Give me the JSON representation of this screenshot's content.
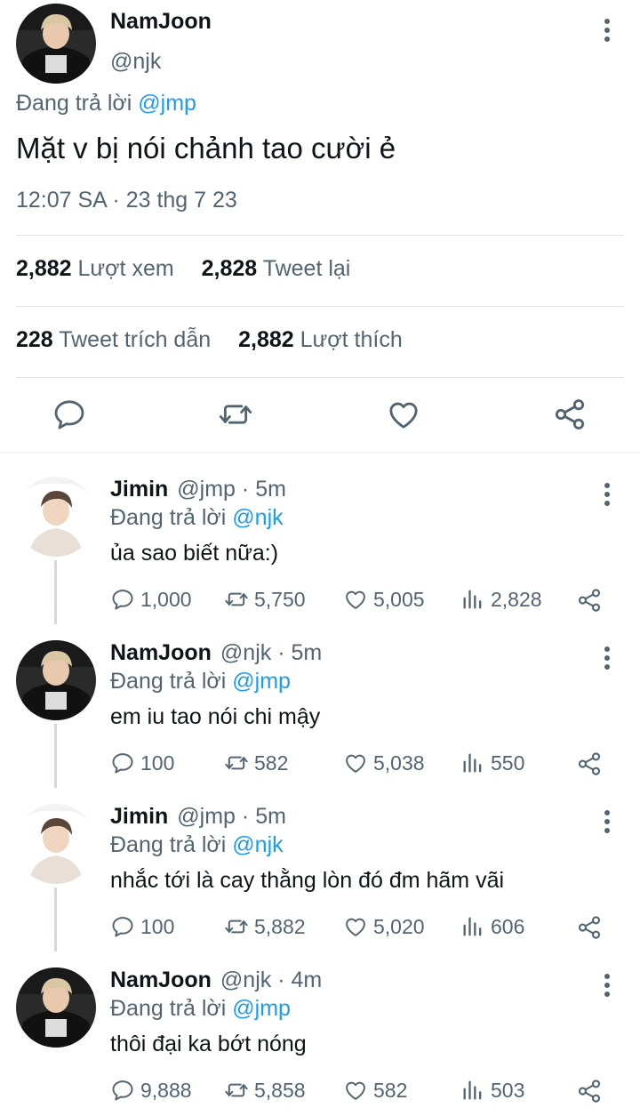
{
  "main_tweet": {
    "author_name": "NamJoon",
    "author_handle": "@njk",
    "replying_prefix": "Đang trả lời ",
    "replying_to": "@jmp",
    "text": "Mặt v bị nói chảnh tao cười ẻ",
    "timestamp": "12:07 SA · 23 thg 7 23",
    "views_count": "2,882",
    "views_label": "Lượt xem",
    "retweets_count": "2,828",
    "retweets_label": "Tweet lại",
    "quotes_count": "228",
    "quotes_label": "Tweet trích dẫn",
    "likes_count": "2,882",
    "likes_label": "Lượt thích"
  },
  "replies": [
    {
      "author_name": "Jimin",
      "author_handle": "@jmp",
      "time": "· 5m",
      "replying_prefix": "Đang trả lời ",
      "replying_to": "@njk",
      "text": "ủa sao biết nữa:)",
      "replies": "1,000",
      "retweets": "5,750",
      "likes": "5,005",
      "views": "2,828"
    },
    {
      "author_name": "NamJoon",
      "author_handle": "@njk",
      "time": "· 5m",
      "replying_prefix": "Đang trả lời ",
      "replying_to": "@jmp",
      "text": "em iu tao nói chi mậy",
      "replies": "100",
      "retweets": "582",
      "likes": "5,038",
      "views": "550"
    },
    {
      "author_name": "Jimin",
      "author_handle": "@jmp",
      "time": "· 5m",
      "replying_prefix": "Đang trả lời ",
      "replying_to": "@njk",
      "text": "nhắc tới là cay thằng lòn đó đm hãm vãi",
      "replies": "100",
      "retweets": "5,882",
      "likes": "5,020",
      "views": "606"
    },
    {
      "author_name": "NamJoon",
      "author_handle": "@njk",
      "time": "· 4m",
      "replying_prefix": "Đang trả lời ",
      "replying_to": "@jmp",
      "text": "thôi đại ka bớt nóng",
      "replies": "9,888",
      "retweets": "5,858",
      "likes": "582",
      "views": "503"
    }
  ],
  "colors": {
    "link": "#1d9bf0",
    "secondary_text": "#536471",
    "primary_text": "#0f1419",
    "divider": "#dfe3e7"
  },
  "icons": [
    "more-vertical-icon",
    "reply-icon",
    "retweet-icon",
    "like-icon",
    "share-icon",
    "views-icon"
  ]
}
